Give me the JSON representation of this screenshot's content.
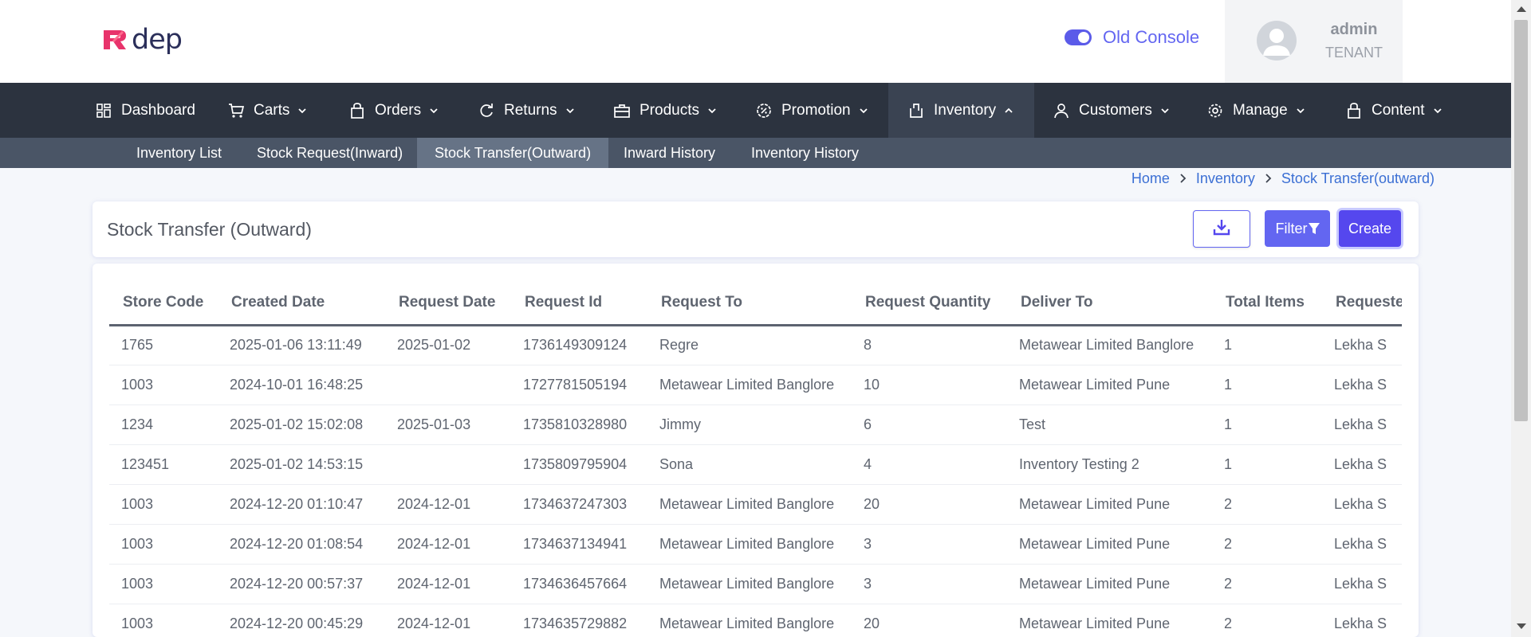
{
  "header": {
    "logo_text": "dep",
    "logo_mark": "R",
    "console_toggle_label": "Old Console",
    "console_toggle_on": true,
    "user_name": "admin",
    "user_role": "TENANT",
    "accent_color": "#6366f1"
  },
  "nav": {
    "items": [
      {
        "label": "Dashboard",
        "icon": "dashboard-icon",
        "dropdown": false
      },
      {
        "label": "Carts",
        "icon": "cart-icon",
        "dropdown": true
      },
      {
        "label": "Orders",
        "icon": "bag-icon",
        "dropdown": true
      },
      {
        "label": "Returns",
        "icon": "refresh-icon",
        "dropdown": true
      },
      {
        "label": "Products",
        "icon": "briefcase-icon",
        "dropdown": true
      },
      {
        "label": "Promotion",
        "icon": "badge-percent-icon",
        "dropdown": true
      },
      {
        "label": "Inventory",
        "icon": "box-icon",
        "dropdown": true,
        "active": true
      },
      {
        "label": "Customers",
        "icon": "user-icon",
        "dropdown": true
      },
      {
        "label": "Manage",
        "icon": "gear-icon",
        "dropdown": true
      },
      {
        "label": "Content",
        "icon": "lock-bag-icon",
        "dropdown": true
      }
    ]
  },
  "subnav": {
    "items": [
      {
        "label": "Inventory List"
      },
      {
        "label": "Stock Request(Inward)"
      },
      {
        "label": "Stock Transfer(Outward)",
        "active": true
      },
      {
        "label": "Inward History"
      },
      {
        "label": "Inventory History"
      }
    ]
  },
  "breadcrumb": {
    "items": [
      "Home",
      "Inventory",
      "Stock Transfer(outward)"
    ]
  },
  "page": {
    "title": "Stock Transfer (Outward)",
    "filter_label": "Filter",
    "create_label": "Create"
  },
  "table": {
    "columns": [
      "Store Code",
      "Created Date",
      "Request Date",
      "Request Id",
      "Request To",
      "Request Quantity",
      "Deliver To",
      "Total Items",
      "Requeste"
    ],
    "rows": [
      [
        "1765",
        "2025-01-06 13:11:49",
        "2025-01-02",
        "1736149309124",
        "Regre",
        "8",
        "Metawear Limited Banglore",
        "1",
        "Lekha S"
      ],
      [
        "1003",
        "2024-10-01 16:48:25",
        "",
        "1727781505194",
        "Metawear Limited Banglore",
        "10",
        "Metawear Limited Pune",
        "1",
        "Lekha S"
      ],
      [
        "1234",
        "2025-01-02 15:02:08",
        "2025-01-03",
        "1735810328980",
        "Jimmy",
        "6",
        "Test",
        "1",
        "Lekha S"
      ],
      [
        "123451",
        "2025-01-02 14:53:15",
        "",
        "1735809795904",
        "Sona",
        "4",
        "Inventory Testing 2",
        "1",
        "Lekha S"
      ],
      [
        "1003",
        "2024-12-20 01:10:47",
        "2024-12-01",
        "1734637247303",
        "Metawear Limited Banglore",
        "20",
        "Metawear Limited Pune",
        "2",
        "Lekha S"
      ],
      [
        "1003",
        "2024-12-20 01:08:54",
        "2024-12-01",
        "1734637134941",
        "Metawear Limited Banglore",
        "3",
        "Metawear Limited Pune",
        "2",
        "Lekha S"
      ],
      [
        "1003",
        "2024-12-20 00:57:37",
        "2024-12-01",
        "1734636457664",
        "Metawear Limited Banglore",
        "3",
        "Metawear Limited Pune",
        "2",
        "Lekha S"
      ],
      [
        "1003",
        "2024-12-20 00:45:29",
        "2024-12-01",
        "1734635729882",
        "Metawear Limited Banglore",
        "20",
        "Metawear Limited Pune",
        "2",
        "Lekha S"
      ]
    ]
  }
}
